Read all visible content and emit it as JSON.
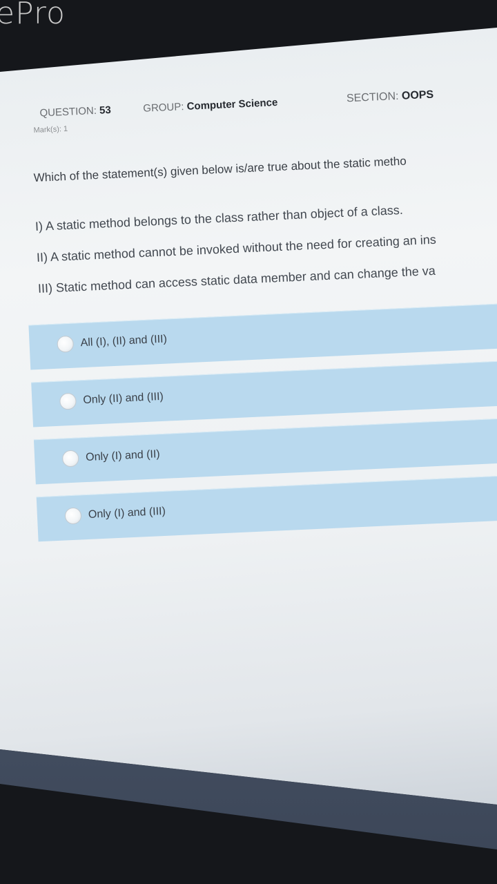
{
  "app": {
    "brand": "ePro"
  },
  "question": {
    "number_label": "QUESTION:",
    "number": "53",
    "group_label": "GROUP:",
    "group": "Computer Science",
    "section_label": "SECTION:",
    "section": "OOPS",
    "marks_label": "Mark(s):",
    "marks": "1",
    "prompt": "Which of the statement(s) given below is/are true about the static metho",
    "statements": [
      "I) A static method belongs to the class rather than object of a class.",
      "II) A static method cannot be invoked without the need for creating an ins",
      "III) Static method can access static data member and can change the va"
    ]
  },
  "options": [
    {
      "label": "All (I), (II) and (III)"
    },
    {
      "label": "Only (II) and (III)"
    },
    {
      "label": "Only (I) and (II)"
    },
    {
      "label": "Only (I) and (III)"
    }
  ]
}
